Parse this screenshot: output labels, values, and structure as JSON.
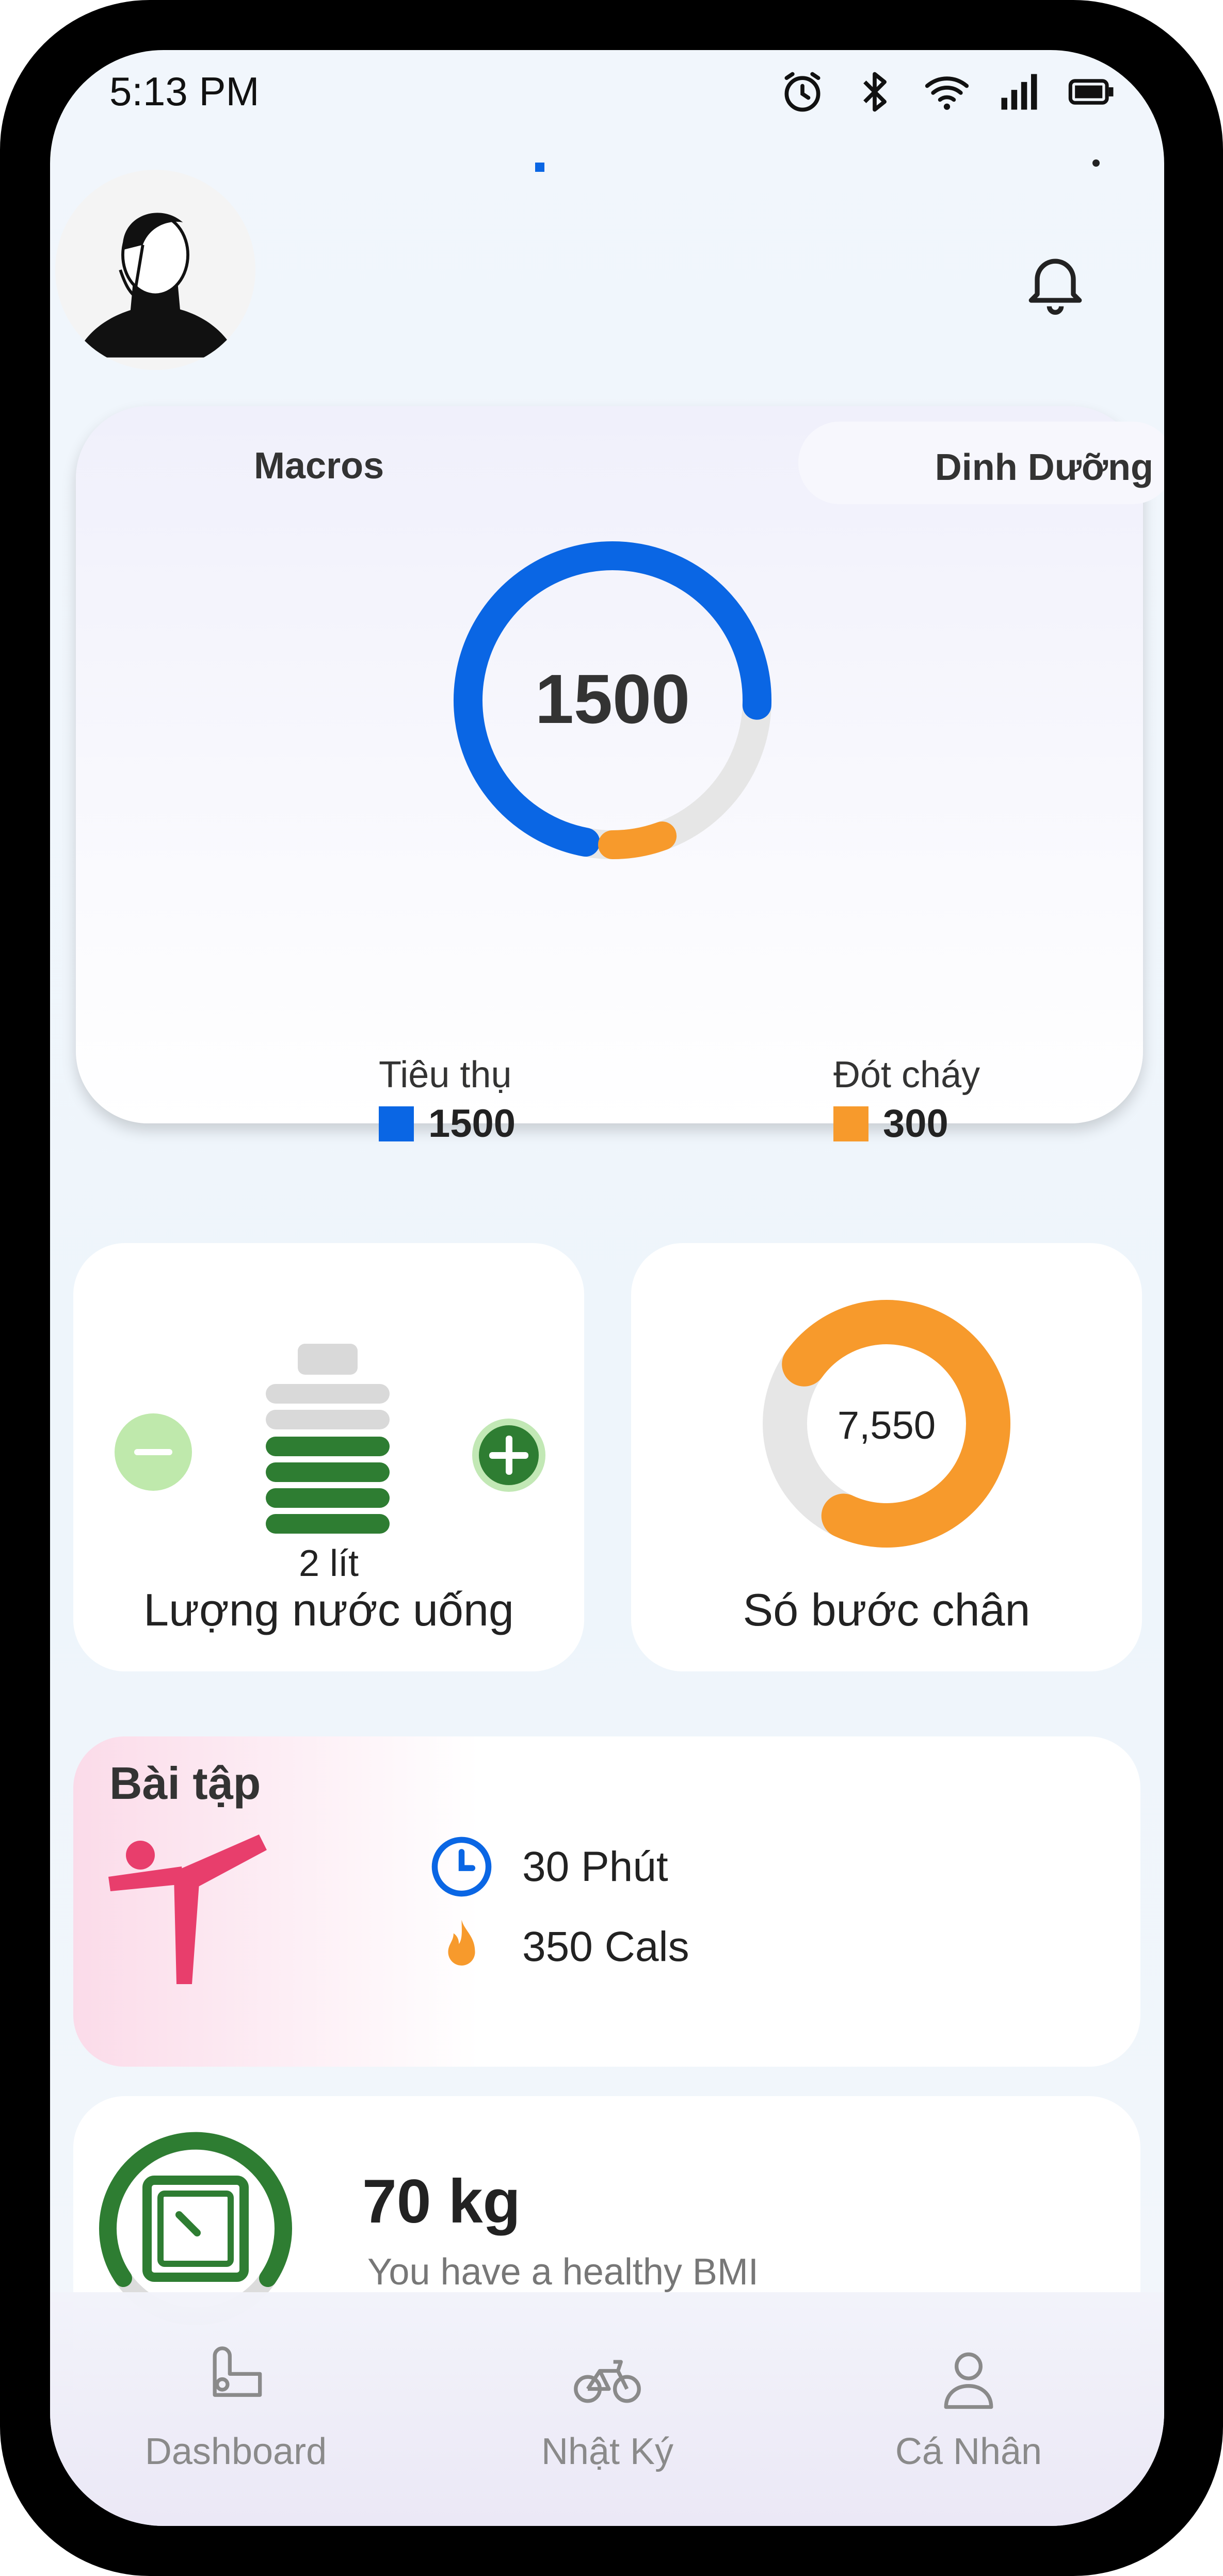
{
  "status_bar": {
    "time": "5:13 PM"
  },
  "macros_card": {
    "tab_macros": "Macros",
    "tab_dinh_duong": "Dinh Dưỡng",
    "total": "1500",
    "consumed": {
      "label": "Tiêu thụ",
      "value": "1500",
      "color": "#0a66e4"
    },
    "burned": {
      "label": "Đót cháy",
      "value": "300",
      "color": "#f79a2c"
    }
  },
  "water_card": {
    "amount": "2 lít",
    "title": "Lượng nước uống",
    "level_fraction": 0.67
  },
  "steps_card": {
    "value": "7,550",
    "title": "Só bước chân",
    "progress_fraction": 0.72
  },
  "exercise_card": {
    "title": "Bài tập",
    "duration": "30 Phút",
    "calories": "350 Cals"
  },
  "bmi_card": {
    "weight": "70 kg",
    "message": "You have a healthy BMI"
  },
  "bottom_nav": [
    {
      "label": "Dashboard",
      "icon": "dashboard-icon"
    },
    {
      "label": "Nhật Ký",
      "icon": "bicycle-icon"
    },
    {
      "label": "Cá Nhân",
      "icon": "person-icon"
    }
  ],
  "colors": {
    "primary_blue": "#0a66e4",
    "orange": "#f79a2c",
    "green": "#2e7d32",
    "pink": "#e83e6c"
  }
}
